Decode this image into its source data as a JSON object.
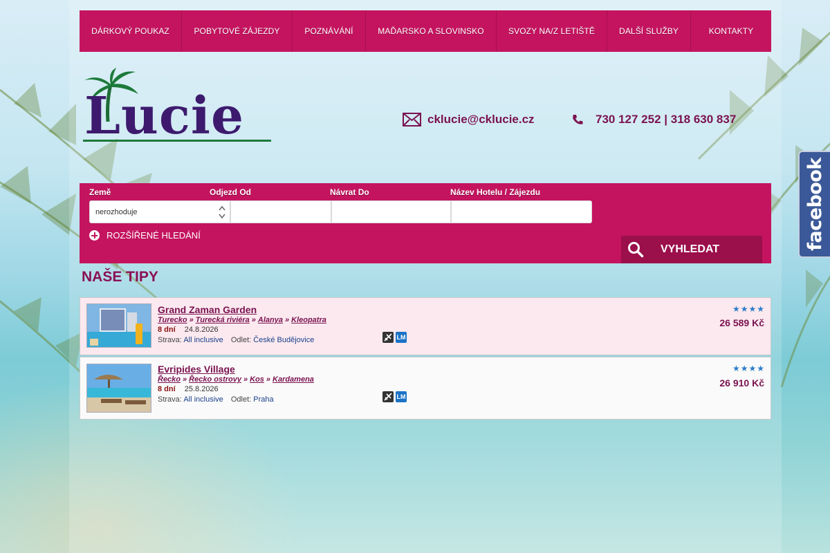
{
  "nav": {
    "items": [
      "DÁRKOVÝ POUKAZ",
      "POBYTOVÉ ZÁJEZDY",
      "POZNÁVÁNÍ",
      "MAĎARSKO A SLOVINSKO",
      "SVOZY NA/Z LETIŠTĚ",
      "DALŠÍ SLUŽBY",
      "KONTAKTY"
    ]
  },
  "logo": {
    "text": "Lucie"
  },
  "contacts": {
    "email": "cklucie@cklucie.cz",
    "phone": "730 127 252 | 318 630 837"
  },
  "facebook": {
    "label": "facebook"
  },
  "search": {
    "labels": {
      "country": "Země",
      "departure": "Odjezd Od",
      "return": "Návrat Do",
      "hotel": "Název Hotelu / Zájezdu"
    },
    "country_value": "nerozhoduje",
    "departure_value": "",
    "return_value": "",
    "hotel_value": "",
    "advanced_label": "ROZŠÍŘENÉ HLEDÁNÍ",
    "button_label": "VYHLEDAT"
  },
  "tips": {
    "title": "NAŠE TIPY",
    "items": [
      {
        "name": "Grand Zaman Garden",
        "breadcrumb": [
          "Turecko",
          "Turecká riviéra",
          "Alanya",
          "Kleopatra"
        ],
        "days": "8 dní",
        "date": "24.8.2026",
        "board_label": "Strava:",
        "board": "All inclusive",
        "departure_label": "Odlet:",
        "departure": "České Budějovice",
        "badge_lm": "LM",
        "stars": 4,
        "price": "26 589 Kč"
      },
      {
        "name": "Evripides Village",
        "breadcrumb": [
          "Řecko",
          "Řecko ostrovy",
          "Kos",
          "Kardamena"
        ],
        "days": "8 dní",
        "date": "25.8.2026",
        "board_label": "Strava:",
        "board": "All inclusive",
        "departure_label": "Odlet:",
        "departure": "Praha",
        "badge_lm": "LM",
        "stars": 4,
        "price": "26 910 Kč"
      }
    ]
  },
  "icons": {
    "email": "envelope-icon",
    "phone": "phone-icon",
    "search": "magnifier-icon",
    "advanced": "plus-circle-icon",
    "flight": "plane-badge-icon",
    "star": "star-icon"
  },
  "colors": {
    "brand": "#c4145f",
    "brand_dark": "#9b0f4b",
    "text_accent": "#7a1250",
    "logo": "#3d1a6e",
    "star": "#2b7cc9",
    "facebook": "#3b5998"
  }
}
